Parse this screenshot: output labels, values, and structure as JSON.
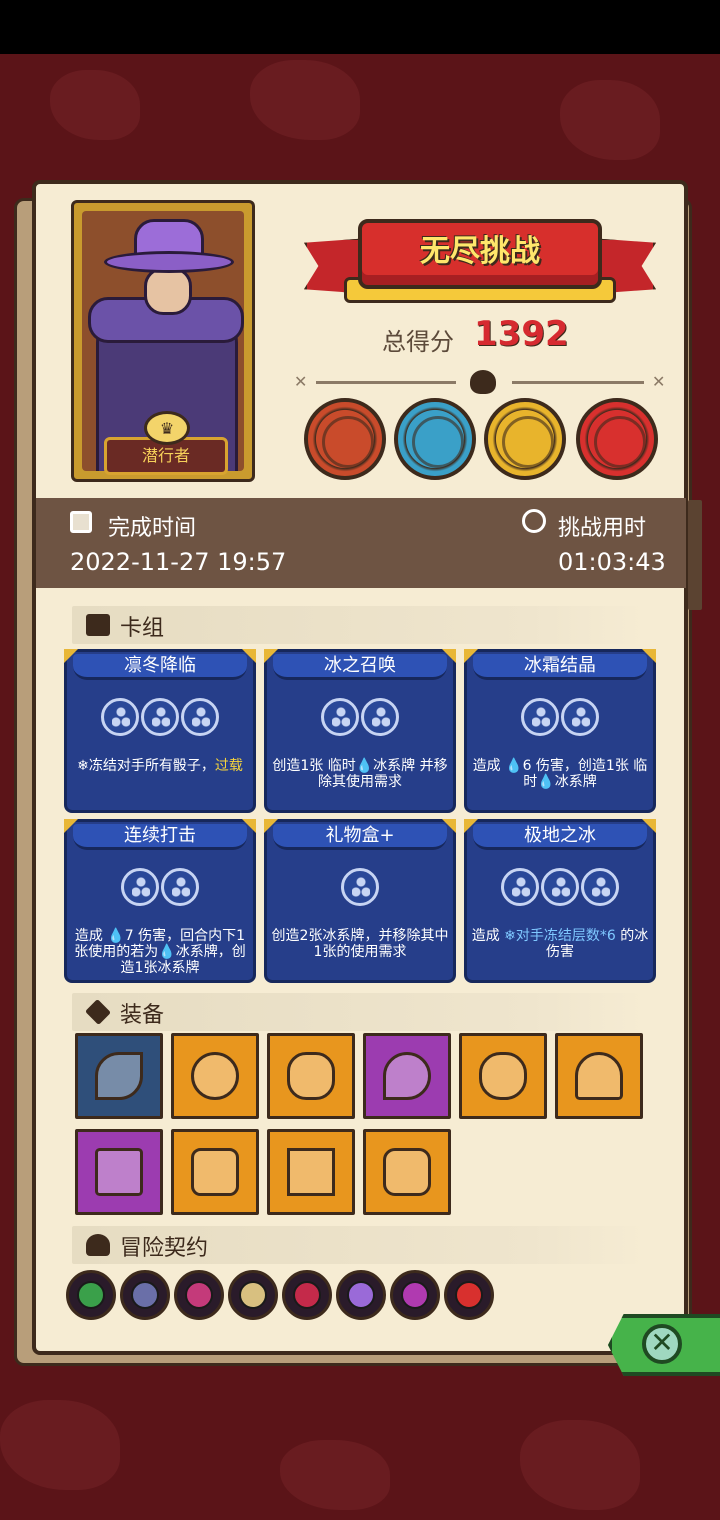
{
  "character": {
    "name": "潜行者"
  },
  "banner": {
    "title": "无尽挑战"
  },
  "score": {
    "label": "总得分",
    "value": "1392"
  },
  "bosses": [
    {
      "icon": "cyclops-boss-icon",
      "color": "#c94b2b"
    },
    {
      "icon": "skull-king-boss-icon",
      "color": "#3aa0c8"
    },
    {
      "icon": "masked-boss-icon",
      "color": "#e8b42c"
    },
    {
      "icon": "red-hat-boss-icon",
      "color": "#d8302e"
    }
  ],
  "info": {
    "completion_label": "完成时间",
    "completion_value": "2022-11-27 19:57",
    "duration_label": "挑战用时",
    "duration_value": "01:03:43"
  },
  "deck": {
    "title": "卡组",
    "cards": [
      {
        "name": "凛冬降临",
        "dice": 3,
        "desc_a": "❄冻结对手所有骰子，",
        "desc_b": "过载"
      },
      {
        "name": "冰之召唤",
        "dice": 2,
        "desc_a": "创造1张 临时💧冰系牌 并移除其使用需求",
        "desc_b": ""
      },
      {
        "name": "冰霜结晶",
        "dice": 2,
        "desc_a": "造成 💧6 伤害，创造1张 临时💧冰系牌",
        "desc_b": ""
      },
      {
        "name": "连续打击",
        "dice": 2,
        "desc_a": "造成 💧7 伤害，回合内下1张使用的若为💧冰系牌，创造1张冰系牌",
        "desc_b": ""
      },
      {
        "name": "礼物盒+",
        "dice": 1,
        "desc_a": "创造2张冰系牌，并移除其中1张的使用需求",
        "desc_b": ""
      },
      {
        "name": "极地之冰",
        "dice": 3,
        "desc_a": "造成 ",
        "desc_b": "❄对手冻结层数*6",
        "desc_c": " 的冰伤害"
      }
    ]
  },
  "equipment": {
    "title": "装备",
    "items": [
      {
        "icon": "scythe-icon",
        "color": "#2f4f7a"
      },
      {
        "icon": "spiked-collar-icon",
        "color": "#e8961e"
      },
      {
        "icon": "ghost-slime-icon",
        "color": "#e8961e"
      },
      {
        "icon": "water-drop-icon",
        "color": "#9c3cb0"
      },
      {
        "icon": "blue-jelly-icon",
        "color": "#e8961e"
      },
      {
        "icon": "dark-heart-icon",
        "color": "#e8961e"
      },
      {
        "icon": "gold-amulet-icon",
        "color": "#9c3cb0"
      },
      {
        "icon": "ice-crystal-icon",
        "color": "#e8961e"
      },
      {
        "icon": "hexagram-badge-icon",
        "color": "#e8961e"
      },
      {
        "icon": "heart-box-icon",
        "color": "#e8961e"
      }
    ]
  },
  "contracts": {
    "title": "冒险契约",
    "items": [
      {
        "icon": "star-shield-contract-icon",
        "color": "#3aa04a"
      },
      {
        "icon": "sword-shield-contract-icon",
        "color": "#6a6fa8"
      },
      {
        "icon": "pink-demon-contract-icon",
        "color": "#c43a7a"
      },
      {
        "icon": "bone-contract-icon",
        "color": "#d8c080"
      },
      {
        "icon": "locked-heart-contract-icon",
        "color": "#c42a4a"
      },
      {
        "icon": "dice-contract-icon",
        "color": "#9a6ad8"
      },
      {
        "icon": "fire-mouth-contract-icon",
        "color": "#b03ab0"
      },
      {
        "icon": "red-demon-contract-icon",
        "color": "#d8302e"
      }
    ]
  },
  "close_button": {
    "icon": "close-icon",
    "label": "✕"
  }
}
